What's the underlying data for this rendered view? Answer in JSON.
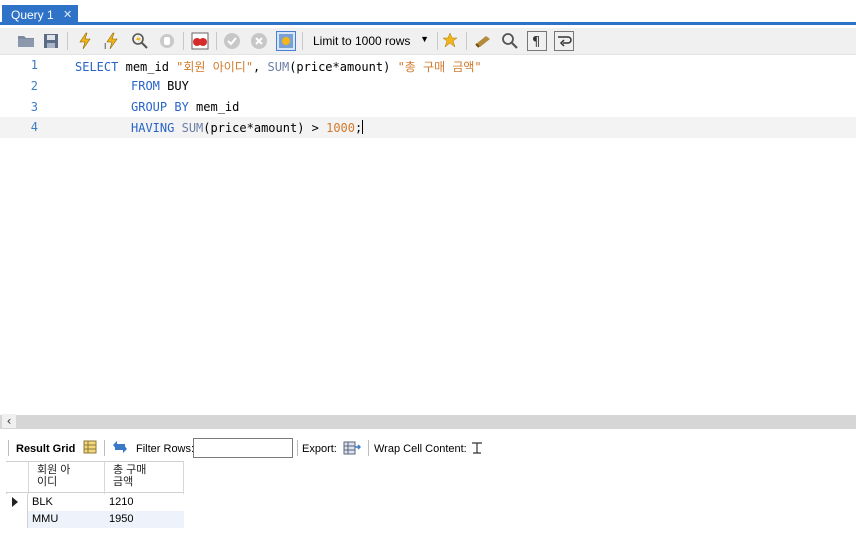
{
  "tabs": [
    {
      "label": "Query 1",
      "close": "✕"
    }
  ],
  "toolbar": {
    "icons": [
      "open-folder-icon",
      "save-icon",
      "execute-icon",
      "execute-current-icon",
      "explain-icon",
      "stop-icon",
      "toggle-error-icon",
      "commit-icon",
      "rollback-icon",
      "autocommit-icon",
      "bookmark-star-icon",
      "beautify-icon",
      "find-icon",
      "invisible-chars-icon",
      "word-wrap-icon"
    ],
    "limit_label": "Limit to 1000 rows"
  },
  "editor": {
    "line_numbers": [
      "1",
      "2",
      "3",
      "4"
    ],
    "lines": [
      {
        "parts": [
          [
            "kw",
            "SELECT"
          ],
          [
            "",
            "mem_id "
          ],
          [
            "str",
            "\"회원 아이디\""
          ],
          [
            "",
            ", "
          ],
          [
            "fn",
            "SUM"
          ],
          [
            "",
            "(price*amount) "
          ],
          [
            "str",
            "\"총 구매 금액\""
          ]
        ]
      },
      {
        "parts": [
          [
            "kw",
            "FROM"
          ],
          [
            "",
            " BUY"
          ]
        ]
      },
      {
        "parts": [
          [
            "kw",
            "GROUP BY"
          ],
          [
            "",
            " mem_id"
          ]
        ]
      },
      {
        "parts": [
          [
            "kw",
            "HAVING"
          ],
          [
            "",
            " "
          ],
          [
            "fn",
            "SUM"
          ],
          [
            "",
            "(price*amount) > "
          ],
          [
            "num",
            "1000"
          ],
          [
            "",
            ";"
          ]
        ]
      }
    ]
  },
  "results": {
    "result_grid_label": "Result Grid",
    "filter_rows_label": "Filter Rows:",
    "filter_value": "",
    "export_label": "Export:",
    "wrap_label": "Wrap Cell Content:",
    "columns": [
      [
        "회원 아",
        "이디"
      ],
      [
        "총 구매",
        "금액"
      ]
    ],
    "rows": [
      [
        "BLK",
        "1210"
      ],
      [
        "MMU",
        "1950"
      ]
    ]
  },
  "colors": {
    "accent": "#2f73c9",
    "keyword": "#2864c8",
    "string": "#d17a2c"
  }
}
